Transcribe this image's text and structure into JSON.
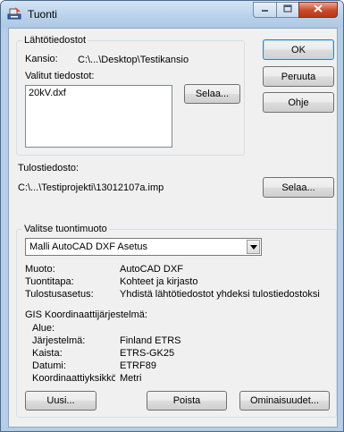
{
  "window": {
    "title": "Tuonti",
    "icon": "import-app-icon"
  },
  "source": {
    "group_label": "Lähtötiedostot",
    "folder_label": "Kansio:",
    "folder_value": "C:\\...\\Desktop\\Testikansio",
    "files_label": "Valitut tiedostot:",
    "files": [
      "20kV.dxf"
    ],
    "browse_label": "Selaa..."
  },
  "buttons": {
    "ok": "OK",
    "cancel": "Peruuta",
    "help": "Ohje"
  },
  "output": {
    "label": "Tulostiedosto:",
    "path": "C:\\...\\Testiprojekti\\13012107a.imp",
    "browse_label": "Selaa..."
  },
  "format": {
    "group_label": "Valitse tuontimuoto",
    "selected": "Malli AutoCAD DXF Asetus",
    "rows": [
      {
        "key": "Muoto:",
        "value": "AutoCAD DXF"
      },
      {
        "key": "Tuontitapa:",
        "value": "Kohteet ja kirjasto"
      },
      {
        "key": "Tulostusasetus:",
        "value": "Yhdistä lähtötiedostot yhdeksi tulostiedostoksi"
      }
    ],
    "gis_label": "GIS Koordinaattijärjestelmä:",
    "gis_rows": [
      {
        "key": "Alue:",
        "value": ""
      },
      {
        "key": "Järjestelmä:",
        "value": "Finland ETRS"
      },
      {
        "key": "Kaista:",
        "value": "ETRS-GK25"
      },
      {
        "key": "Datumi:",
        "value": "ETRF89"
      },
      {
        "key": "Koordinaattiyksikkö",
        "value": "Metri"
      }
    ],
    "new_label": "Uusi...",
    "delete_label": "Poista",
    "properties_label": "Ominaisuudet..."
  }
}
